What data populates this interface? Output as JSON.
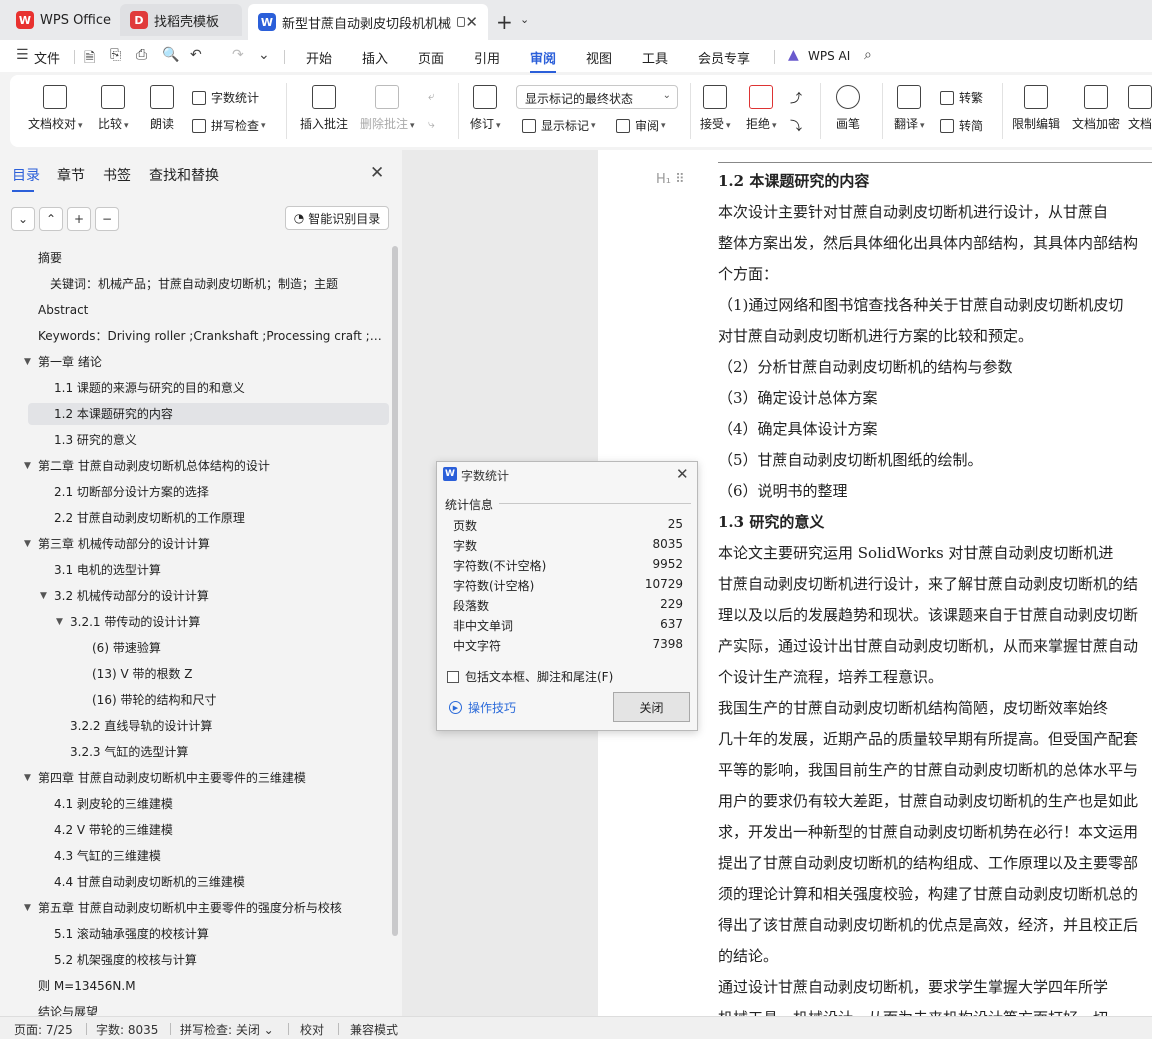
{
  "tabs": [
    {
      "label": "WPS Office",
      "icon": "wps-logo-icon"
    },
    {
      "label": "找稻壳模板",
      "icon": "docer-icon"
    },
    {
      "label": "新型甘蔗自动剥皮切段机机械",
      "icon": "writer-doc-icon"
    }
  ],
  "menu": {
    "file": "文件",
    "items": [
      "开始",
      "插入",
      "页面",
      "引用",
      "审阅",
      "视图",
      "工具",
      "会员专享"
    ],
    "active": "审阅",
    "wps_ai": "WPS AI"
  },
  "ribbon": {
    "doc_check": "文档校对",
    "compare": "比较",
    "read_aloud": "朗读",
    "word_count": "字数统计",
    "spell_check": "拼写检查",
    "insert_comment": "插入批注",
    "delete_comment": "删除批注",
    "revise": "修订",
    "markup_state": "显示标记的最终状态",
    "show_markup": "显示标记",
    "review": "审阅",
    "accept": "接受",
    "reject": "拒绝",
    "brush": "画笔",
    "translate": "翻译",
    "to_traditional": "转繁",
    "to_simplified": "转简",
    "restrict_edit": "限制编辑",
    "encrypt": "文档加密",
    "doc_more": "文档"
  },
  "panel": {
    "tabs": [
      "目录",
      "章节",
      "书签",
      "查找和替换"
    ],
    "smart_toc": "智能识别目录"
  },
  "toc": [
    {
      "text": "摘要",
      "level": 0
    },
    {
      "text": "关键词：机械产品；甘蔗自动剥皮切断机；制造；主题",
      "level": 1
    },
    {
      "text": "Abstract",
      "level": 0
    },
    {
      "text": "Keywords：Driving roller ;Crankshaft ;Processing craft ;Si ...",
      "level": 0
    },
    {
      "text": "第一章  绪论",
      "level": 0,
      "arrow": true
    },
    {
      "text": "1.1  课题的来源与研究的目的和意义",
      "level": 2
    },
    {
      "text": "1.2  本课题研究的内容",
      "level": 2,
      "selected": true
    },
    {
      "text": "1.3  研究的意义",
      "level": 2
    },
    {
      "text": "第二章  甘蔗自动剥皮切断机总体结构的设计",
      "level": 0,
      "arrow": true
    },
    {
      "text": "2.1 切断部分设计方案的选择",
      "level": 2
    },
    {
      "text": "2.2 甘蔗自动剥皮切断机的工作原理",
      "level": 2
    },
    {
      "text": "第三章  机械传动部分的设计计算",
      "level": 0,
      "arrow": true
    },
    {
      "text": "3.1 电机的选型计算",
      "level": 2
    },
    {
      "text": "3.2  机械传动部分的设计计算",
      "level": 2,
      "arrow": true
    },
    {
      "text": "3.2.1  带传动的设计计算",
      "level": 3,
      "arrow": true
    },
    {
      "text": "(6)  带速验算",
      "level": 4
    },
    {
      "text": "(13)  V 带的根数 Z",
      "level": 4
    },
    {
      "text": "(16)  带轮的结构和尺寸",
      "level": 4
    },
    {
      "text": "3.2.2 直线导轨的设计计算",
      "level": 3
    },
    {
      "text": "3.2.3  气缸的选型计算",
      "level": 3
    },
    {
      "text": "第四章  甘蔗自动剥皮切断机中主要零件的三维建模",
      "level": 0,
      "arrow": true
    },
    {
      "text": "4.1 剥皮轮的三维建模",
      "level": 2
    },
    {
      "text": "4.2 V 带轮的三维建模",
      "level": 2
    },
    {
      "text": "4.3 气缸的三维建模",
      "level": 2
    },
    {
      "text": "4.4 甘蔗自动剥皮切断机的三维建模",
      "level": 2
    },
    {
      "text": "第五章  甘蔗自动剥皮切断机中主要零件的强度分析与校核",
      "level": 0,
      "arrow": true
    },
    {
      "text": "5.1 滚动轴承强度的校核计算",
      "level": 2
    },
    {
      "text": "5.2 机架强度的校核与计算",
      "level": 2
    },
    {
      "text": "则 M=13456N.M",
      "level": 0
    },
    {
      "text": "结论与展望",
      "level": 0
    }
  ],
  "document": {
    "lines": [
      {
        "text": "1.2  本课题研究的内容",
        "heading": true
      },
      {
        "text": "    本次设计主要针对甘蔗自动剥皮切断机进行设计，从甘蔗自"
      },
      {
        "text": "整体方案出发，然后具体细化出具体内部结构，其具体内部结构"
      },
      {
        "text": "个方面："
      },
      {
        "text": "（1)通过网络和图书馆查找各种关于甘蔗自动剥皮切断机皮切"
      },
      {
        "text": "对甘蔗自动剥皮切断机进行方案的比较和预定。"
      },
      {
        "text": "（2）分析甘蔗自动剥皮切断机的结构与参数"
      },
      {
        "text": "（3）确定设计总体方案"
      },
      {
        "text": "（4）确定具体设计方案"
      },
      {
        "text": "（5）甘蔗自动剥皮切断机图纸的绘制。"
      },
      {
        "text": "（6）说明书的整理"
      },
      {
        "text": "1.3  研究的意义",
        "heading": true
      },
      {
        "text": "    本论文主要研究运用 SolidWorks 对甘蔗自动剥皮切断机进"
      },
      {
        "text": "甘蔗自动剥皮切断机进行设计，来了解甘蔗自动剥皮切断机的结"
      },
      {
        "text": "理以及以后的发展趋势和现状。该课题来自于甘蔗自动剥皮切断"
      },
      {
        "text": "产实际，通过设计出甘蔗自动剥皮切断机，从而来掌握甘蔗自动"
      },
      {
        "text": "个设计生产流程，培养工程意识。"
      },
      {
        "text": "    我国生产的甘蔗自动剥皮切断机结构简陋，皮切断效率始终"
      },
      {
        "text": "几十年的发展，近期产品的质量较早期有所提高。但受国产配套"
      },
      {
        "text": "平等的影响，我国目前生产的甘蔗自动剥皮切断机的总体水平与"
      },
      {
        "text": "用户的要求仍有较大差距，甘蔗自动剥皮切断机的生产也是如此"
      },
      {
        "text": "求，开发出一种新型的甘蔗自动剥皮切断机势在必行！本文运用"
      },
      {
        "text": "提出了甘蔗自动剥皮切断机的结构组成、工作原理以及主要零部"
      },
      {
        "text": "须的理论计算和相关强度校验，构建了甘蔗自动剥皮切断机总的"
      },
      {
        "text": "得出了该甘蔗自动剥皮切断机的优点是高效，经济，并且校正后"
      },
      {
        "text": "的结论。"
      },
      {
        "text": "    通过设计甘蔗自动剥皮切断机，要求学生掌握大学四年所学"
      },
      {
        "text": "机械工具、机械设计、从而为未来机构设计等方面打好一切"
      }
    ]
  },
  "dialog": {
    "title": "字数统计",
    "section": "统计信息",
    "stats": [
      {
        "label": "页数",
        "value": "25"
      },
      {
        "label": "字数",
        "value": "8035"
      },
      {
        "label": "字符数(不计空格)",
        "value": "9952"
      },
      {
        "label": "字符数(计空格)",
        "value": "10729"
      },
      {
        "label": "段落数",
        "value": "229"
      },
      {
        "label": "非中文单词",
        "value": "637"
      },
      {
        "label": "中文字符",
        "value": "7398"
      }
    ],
    "checkbox": "包括文本框、脚注和尾注(F)",
    "tips": "操作技巧",
    "close": "关闭"
  },
  "status": {
    "page": "页面: 7/25",
    "words": "字数: 8035",
    "spell": "拼写检查: 关闭",
    "proof": "校对",
    "compat": "兼容模式"
  },
  "colors": {
    "accent": "#2b5fd9",
    "wps_red": "#e8312f",
    "docer_red": "#e03b3b",
    "writer_blue": "#2b5fd9"
  }
}
